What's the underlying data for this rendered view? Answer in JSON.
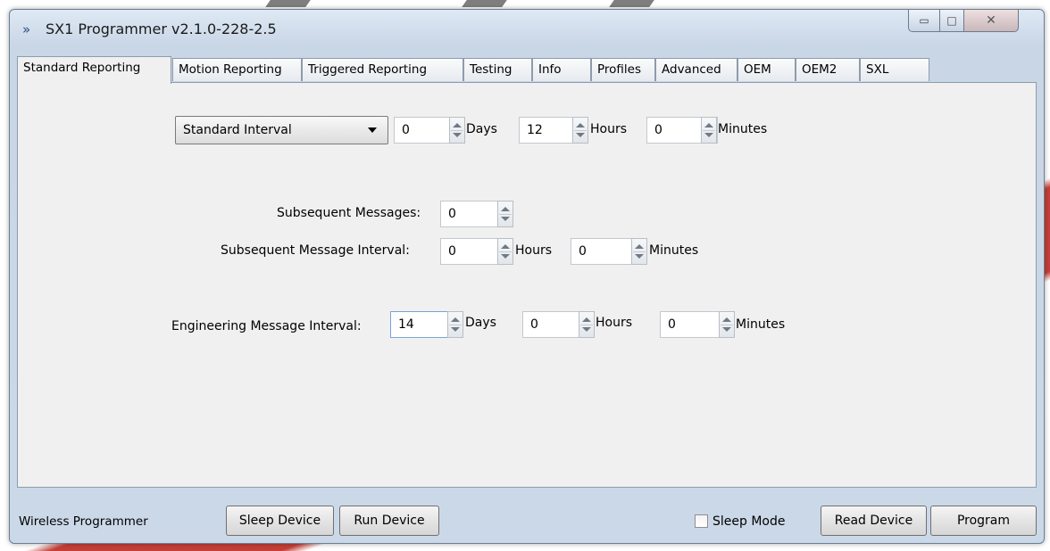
{
  "window": {
    "title": "SX1 Programmer v2.1.0-228-2.5",
    "minimize_glyph": "▭",
    "maximize_glyph": "□",
    "close_glyph": "✕",
    "app_icon": "»"
  },
  "tabs": [
    {
      "label": "Standard Reporting",
      "active": true
    },
    {
      "label": "Motion Reporting"
    },
    {
      "label": "Triggered Reporting"
    },
    {
      "label": "Testing"
    },
    {
      "label": "Info"
    },
    {
      "label": "Profiles"
    },
    {
      "label": "Advanced"
    },
    {
      "label": "OEM"
    },
    {
      "label": "OEM2"
    },
    {
      "label": "SXL"
    }
  ],
  "standard": {
    "mode": "Standard Interval",
    "days_value": "0",
    "days_label": "Days",
    "hours_value": "12",
    "hours_label": "Hours",
    "minutes_value": "0",
    "minutes_label": "Minutes"
  },
  "subsequent": {
    "messages_label": "Subsequent Messages:",
    "messages_value": "0",
    "interval_label": "Subsequent Message Interval:",
    "hours_value": "0",
    "hours_label": "Hours",
    "minutes_value": "0",
    "minutes_label": "Minutes"
  },
  "engineering": {
    "label": "Engineering Message Interval:",
    "days_value": "14",
    "days_label": "Days",
    "hours_value": "0",
    "hours_label": "Hours",
    "minutes_value": "0",
    "minutes_label": "Minutes"
  },
  "bottom": {
    "status": "Wireless Programmer",
    "sleep_device": "Sleep Device",
    "run_device": "Run Device",
    "sleep_mode_label": "Sleep Mode",
    "sleep_mode_checked": false,
    "read_device": "Read Device",
    "program": "Program"
  }
}
